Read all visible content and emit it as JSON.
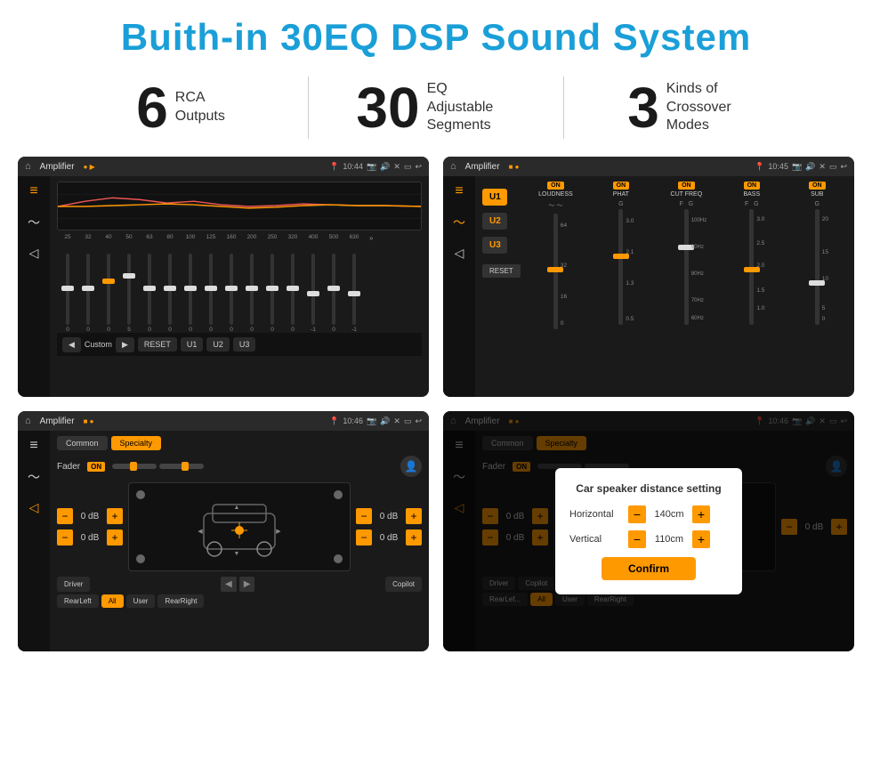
{
  "header": {
    "title": "Buith-in 30EQ DSP Sound System"
  },
  "stats": [
    {
      "number": "6",
      "label": "RCA\nOutputs"
    },
    {
      "number": "30",
      "label": "EQ Adjustable\nSegments"
    },
    {
      "number": "3",
      "label": "Kinds of\nCrossover Modes"
    }
  ],
  "screens": [
    {
      "id": "eq",
      "topbar": {
        "title": "Amplifier",
        "time": "10:44"
      },
      "freqs": [
        "25",
        "32",
        "40",
        "50",
        "63",
        "80",
        "100",
        "125",
        "160",
        "200",
        "250",
        "320",
        "400",
        "500",
        "630"
      ],
      "values": [
        "0",
        "0",
        "0",
        "5",
        "0",
        "0",
        "0",
        "0",
        "0",
        "0",
        "0",
        "0",
        "-1",
        "0",
        "-1"
      ],
      "preset": "Custom",
      "buttons": [
        "RESET",
        "U1",
        "U2",
        "U3"
      ]
    },
    {
      "id": "crossover",
      "topbar": {
        "title": "Amplifier",
        "time": "10:45"
      },
      "channels": [
        "U1",
        "U2",
        "U3"
      ],
      "params": [
        "LOUDNESS",
        "PHAT",
        "CUT FREQ",
        "BASS",
        "SUB"
      ]
    },
    {
      "id": "fader",
      "topbar": {
        "title": "Amplifier",
        "time": "10:46"
      },
      "tabs": [
        "Common",
        "Specialty"
      ],
      "activeTab": "Specialty",
      "faderLabel": "Fader",
      "faderOn": "ON",
      "dbValues": [
        "0 dB",
        "0 dB",
        "0 dB",
        "0 dB"
      ],
      "positions": [
        "Driver",
        "Copilot",
        "RearLeft",
        "All",
        "User",
        "RearRight"
      ]
    },
    {
      "id": "fader-dialog",
      "topbar": {
        "title": "Amplifier",
        "time": "10:46"
      },
      "tabs": [
        "Common",
        "Specialty"
      ],
      "activeTab": "Specialty",
      "dialog": {
        "title": "Car speaker distance setting",
        "horizontal_label": "Horizontal",
        "horizontal_value": "140cm",
        "vertical_label": "Vertical",
        "vertical_value": "110cm",
        "confirm_label": "Confirm"
      }
    }
  ]
}
